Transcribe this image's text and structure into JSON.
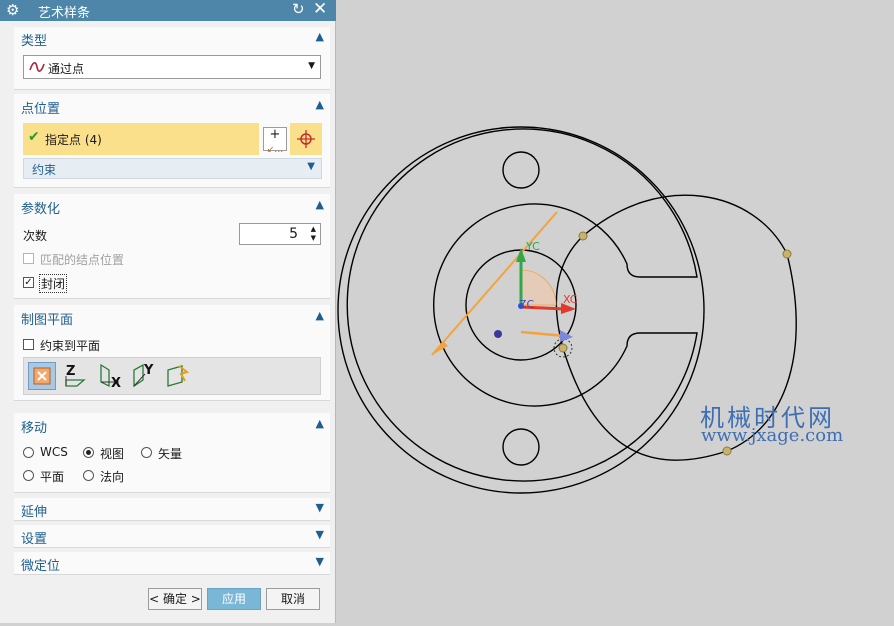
{
  "dialog": {
    "title": "艺术样条",
    "type_section": {
      "header": "类型",
      "value": "通过点"
    },
    "point_section": {
      "header": "点位置",
      "specify_label": "指定点 (4)",
      "constraint_label": "约束"
    },
    "param_section": {
      "header": "参数化",
      "degree_label": "次数",
      "degree_value": "5",
      "match_knots_label": "匹配的结点位置",
      "match_knots_checked": false,
      "closed_label": "封闭",
      "closed_checked": true
    },
    "plane_section": {
      "header": "制图平面",
      "constrain_label": "约束到平面",
      "constrain_checked": false,
      "z_label": "Z",
      "x_label": "X",
      "y_label": "Y"
    },
    "move_section": {
      "header": "移动",
      "options": [
        "WCS",
        "视图",
        "矢量",
        "平面",
        "法向"
      ],
      "selected": "视图"
    },
    "extend_section": {
      "header": "延伸"
    },
    "settings_section": {
      "header": "设置"
    },
    "fine_section": {
      "header": "微定位"
    },
    "buttons": {
      "ok": "< 确定 >",
      "apply": "应用",
      "cancel": "取消"
    }
  },
  "viewport": {
    "axis_labels": {
      "yc": "YC",
      "xc": "XC",
      "zc": "ZC"
    },
    "watermark": {
      "line1": "机械时代网",
      "line2": "www.jxage.com"
    },
    "colors": {
      "geometry": "#000000",
      "spline_point": "#c9b36a",
      "x_axis": "#e23a2a",
      "y_axis": "#2fa84a",
      "z_axis": "#2f4fd8",
      "drag_handle": "#f5a23a"
    }
  }
}
